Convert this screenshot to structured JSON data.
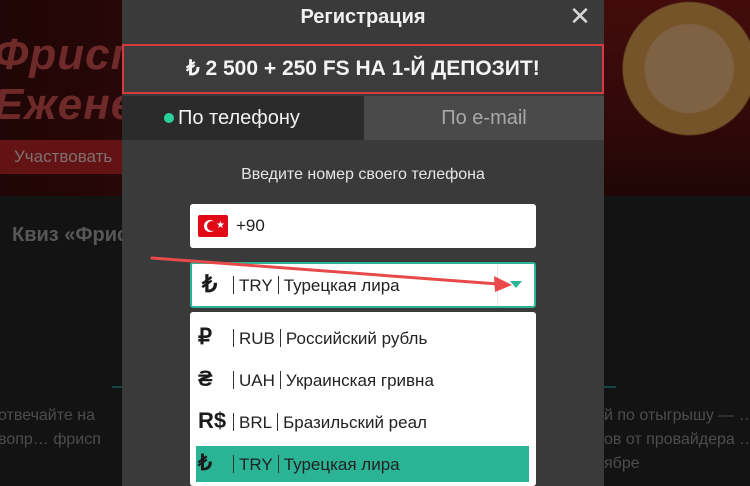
{
  "background": {
    "promo_line1": "Фрисп",
    "promo_line2": "Еженед",
    "join_button": "Участвовать",
    "quiz_title": "Квиз «Фрис",
    "text_left": "отвечайте на вопр… фрисп",
    "text_right": "й по отыгрышу — … ов от провайдера … ябре"
  },
  "modal": {
    "title": "Регистрация",
    "close_symbol": "✕",
    "bonus_banner": "₺ 2 500 + 250 FS НА 1-Й ДЕПОЗИТ!",
    "tabs": [
      {
        "label": "По телефону",
        "active": true
      },
      {
        "label": "По e-mail",
        "active": false
      }
    ],
    "phone_hint": "Введите номер своего телефона",
    "phone": {
      "country_flag": "turkey-flag",
      "code": "+90"
    },
    "currency_select": {
      "symbol": "₺",
      "code": "TRY",
      "name": "Турецкая лира"
    },
    "currency_options": [
      {
        "symbol": "₽",
        "code": "RUB",
        "name": "Российский рубль",
        "selected": false
      },
      {
        "symbol": "₴",
        "code": "UAH",
        "name": "Украинская гривна",
        "selected": false
      },
      {
        "symbol": "R$",
        "code": "BRL",
        "name": "Бразильский реал",
        "selected": false
      },
      {
        "symbol": "₺",
        "code": "TRY",
        "name": "Турецкая лира",
        "selected": true
      }
    ]
  },
  "colors": {
    "accent": "#2bb396",
    "banner_border": "#d63a3a",
    "modal_bg": "#3a3a3a",
    "annotation_arrow": "#e84a4a"
  }
}
